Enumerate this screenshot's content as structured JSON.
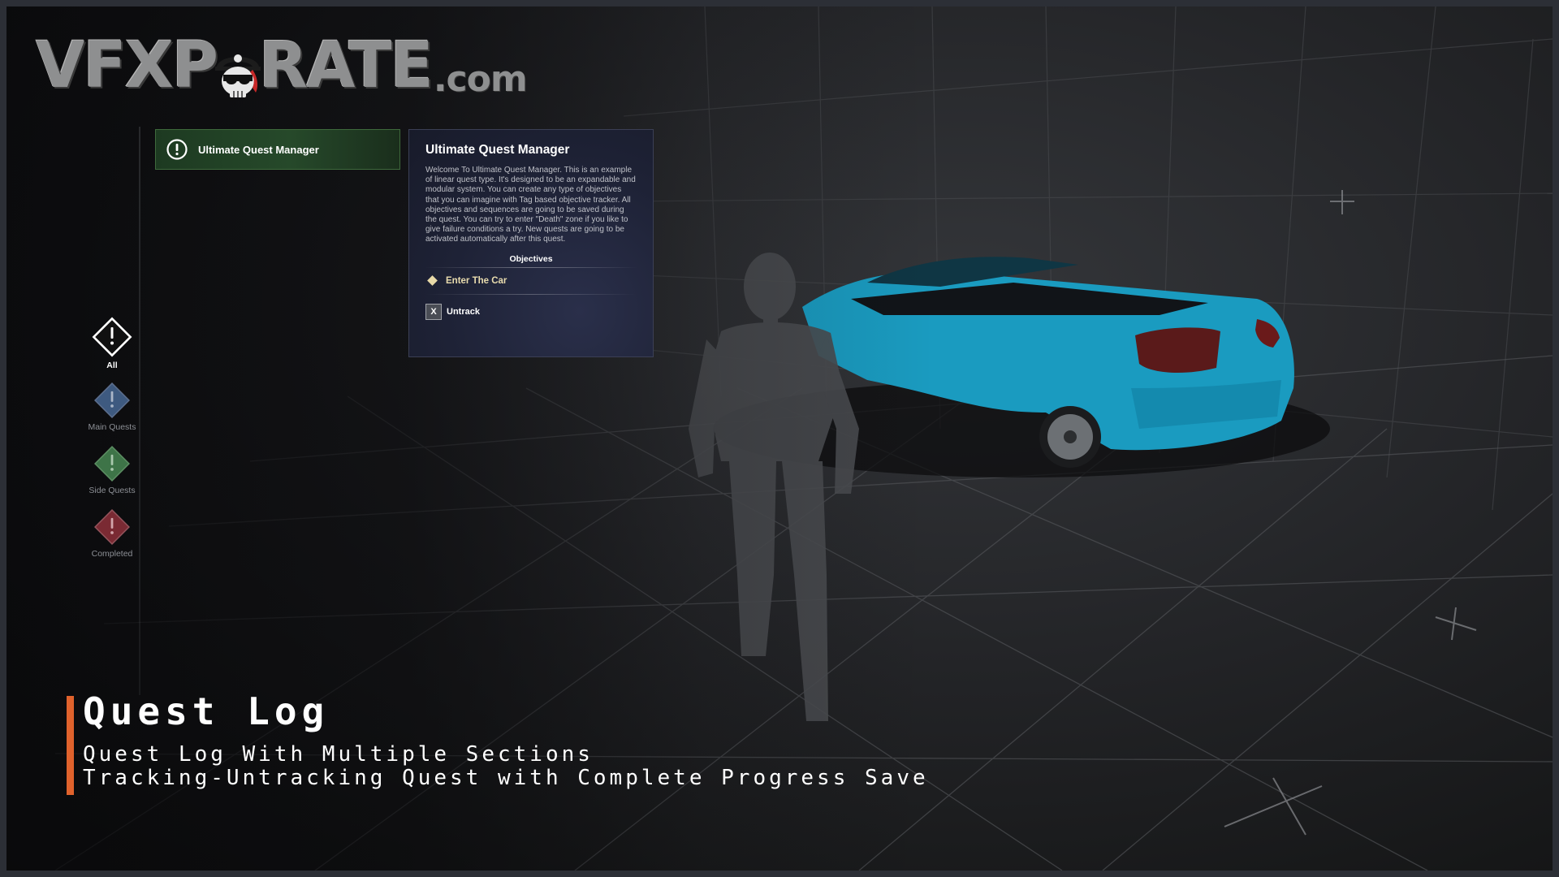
{
  "logo": {
    "text_left": "VFXP",
    "text_right": "RATE",
    "domain": ".com"
  },
  "quest_list": {
    "items": [
      {
        "title": "Ultimate Quest Manager",
        "icon": "exclamation-circle-icon",
        "selected": true
      }
    ]
  },
  "quest_detail": {
    "title": "Ultimate Quest Manager",
    "description": "Welcome To Ultimate Quest Manager. This is an example of linear quest type. It's designed to be an expandable and modular system. You can create any type of objectives that you can imagine with Tag based objective tracker. All objectives and sequences are going to be saved during the quest. You can try to enter \"Death\" zone if you like to give failure conditions a try. New quests are going to be activated automatically after this quest.",
    "objectives_header": "Objectives",
    "objectives": [
      {
        "label": "Enter The Car",
        "icon": "diamond-icon"
      }
    ],
    "untrack": {
      "key": "X",
      "label": "Untrack"
    }
  },
  "categories": [
    {
      "label": "All",
      "icon": "diamond-exclamation-icon",
      "color": "#ffffff",
      "active": true
    },
    {
      "label": "Main Quests",
      "icon": "diamond-exclamation-icon",
      "color": "#3e5a80",
      "active": false
    },
    {
      "label": "Side Quests",
      "icon": "diamond-exclamation-icon",
      "color": "#3e7448",
      "active": false
    },
    {
      "label": "Completed",
      "icon": "diamond-exclamation-icon",
      "color": "#7a2a33",
      "active": false
    }
  ],
  "caption": {
    "title": "Quest Log",
    "line1": "Quest Log With Multiple Sections",
    "line2": "Tracking-Untracking Quest with Complete Progress Save",
    "accent_color": "#e0622c"
  },
  "colors": {
    "quest_item_bg": "#26492a",
    "panel_bg": "#1e2236",
    "car_body": "#1a9bc0",
    "objective_text": "#e9dcae"
  }
}
